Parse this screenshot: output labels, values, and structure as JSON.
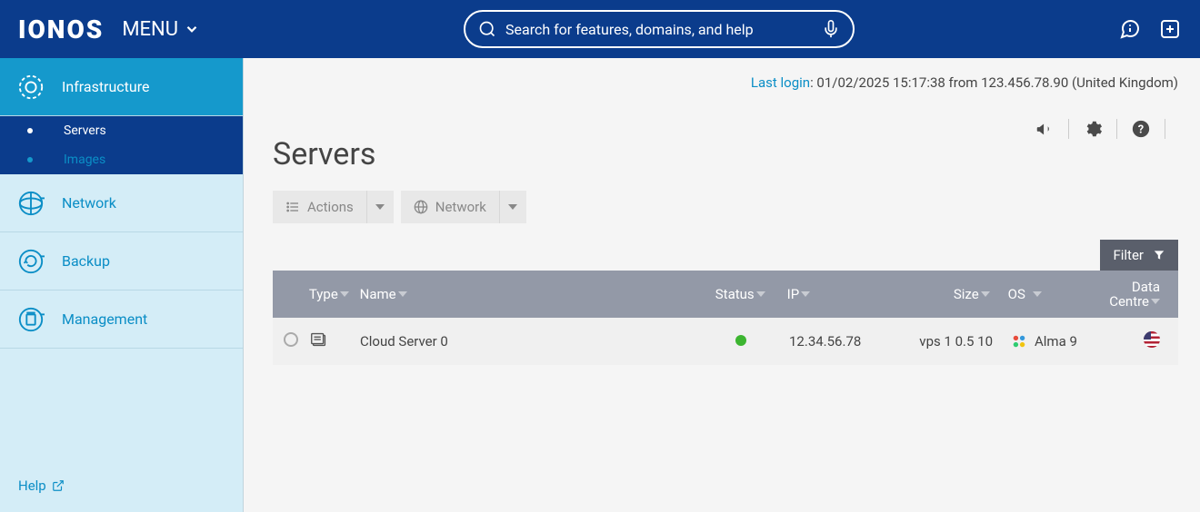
{
  "header": {
    "logo": "IONOS",
    "menu_label": "MENU",
    "search_placeholder": "Search for features, domains, and help"
  },
  "sidebar": {
    "infrastructure": "Infrastructure",
    "servers": "Servers",
    "images": "Images",
    "network": "Network",
    "backup": "Backup",
    "management": "Management",
    "help": "Help"
  },
  "last_login": {
    "label": "Last login",
    "text": ": 01/02/2025 15:17:38 from 123.456.78.90 (United Kingdom)"
  },
  "page": {
    "title": "Servers",
    "actions_btn": "Actions",
    "network_btn": "Network",
    "filter_btn": "Filter"
  },
  "table": {
    "headers": {
      "type": "Type",
      "name": "Name",
      "status": "Status",
      "ip": "IP",
      "size": "Size",
      "os": "OS",
      "dc1": "Data",
      "dc2": "Centre"
    },
    "rows": [
      {
        "name": "Cloud Server 0",
        "ip": "12.34.56.78",
        "size": "vps 1 0.5 10",
        "os": "Alma 9"
      }
    ]
  }
}
